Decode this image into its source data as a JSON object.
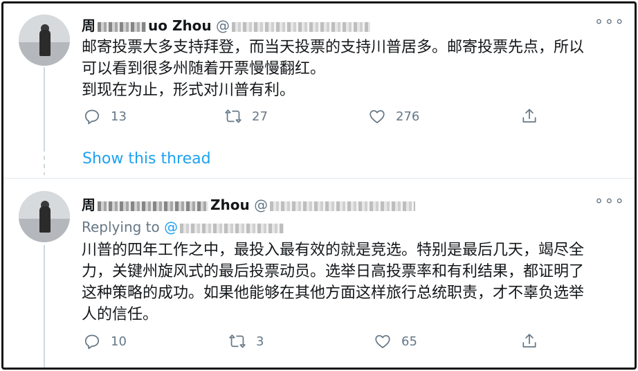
{
  "tweet1": {
    "name": "周",
    "name_end": "uo Zhou",
    "handle_start": "@",
    "text_lines": [
      "邮寄投票大多支持拜登，而当天投票的支持川普居多。邮寄投票先点，所以",
      "可以看到很多州随着开票慢慢翻红。",
      "到现在为止，形式对川普有利。"
    ],
    "reply_count": "13",
    "retweet_count": "27",
    "like_count": "276",
    "show_thread": "Show this thread",
    "more_label": "∘∘∘"
  },
  "tweet2": {
    "name": "周",
    "name_end": "Zhou",
    "handle_start": "@",
    "replying_label": "Replying to ",
    "replying_at": "@",
    "text_lines": [
      "川普的四年工作之中，最投入最有效的就是竞选。特别是最后几天，竭尽全",
      "力，关键州旋风式的最后投票动员。选举日高投票率和有利结果，都证明了",
      "这种策略的成功。如果他能够在其他方面这样旅行总统职责，才不辜负选举",
      "人的信任。"
    ],
    "reply_count": "10",
    "retweet_count": "3",
    "like_count": "65",
    "more_label": "∘∘∘"
  },
  "icons": {
    "reply": "reply-icon",
    "retweet": "retweet-icon",
    "like": "heart-icon",
    "share": "share-icon",
    "more": "more-icon"
  },
  "colors": {
    "link": "#1da1f2",
    "secondary": "#657786",
    "text": "#14171a"
  }
}
